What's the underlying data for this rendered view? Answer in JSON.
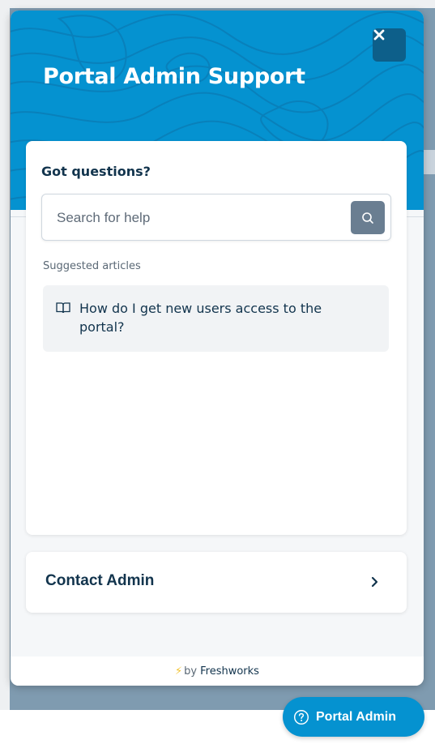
{
  "widget": {
    "title": "Portal Admin Support",
    "close_icon": "close-icon"
  },
  "help_card": {
    "title": "Got questions?",
    "search": {
      "placeholder": "Search for help",
      "value": "",
      "icon": "search-icon"
    },
    "suggested_label": "Suggested articles",
    "articles": [
      {
        "icon": "book-icon",
        "title": "How do I get new users access to the portal?"
      }
    ]
  },
  "contact": {
    "label": "Contact Admin",
    "icon": "chevron-right-icon"
  },
  "footer": {
    "bolt": "⚡",
    "by": "by",
    "brand": "Freshworks"
  },
  "launcher": {
    "label": "Portal Admin",
    "icon": "question-circle-icon"
  },
  "colors": {
    "brand_blue": "#0592d0",
    "close_bg": "#0d5f8a",
    "text_dark": "#12344d",
    "search_button": "#6a7e91",
    "overlay": "#7f9bb0"
  }
}
